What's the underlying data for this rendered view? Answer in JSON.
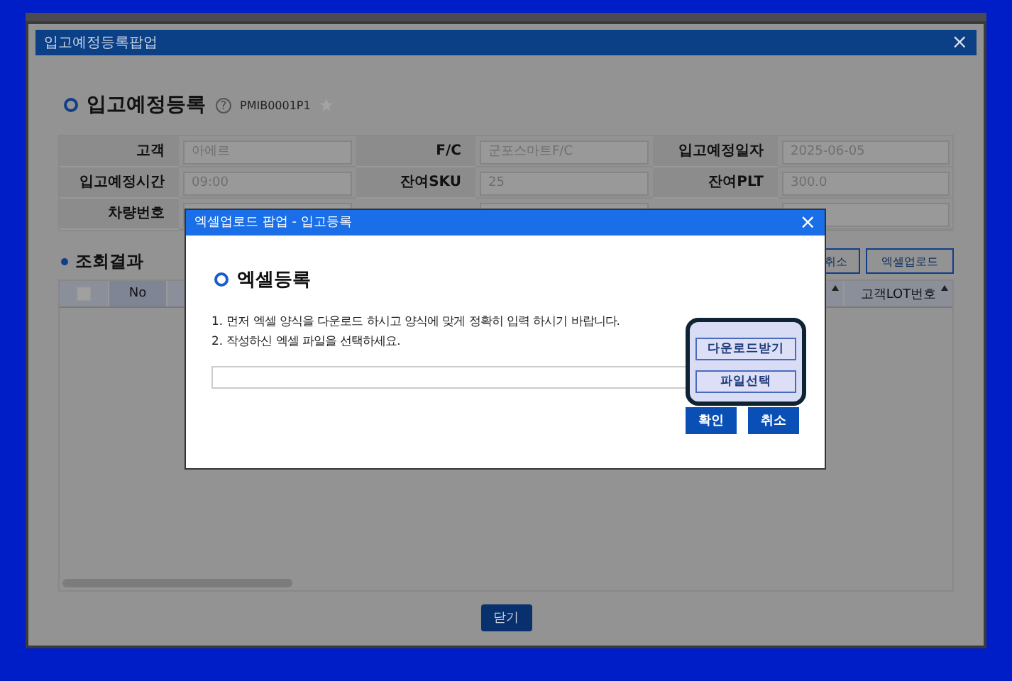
{
  "popup": {
    "title": "입고예정등록팝업",
    "close": "×",
    "heading": "입고예정등록",
    "help": "?",
    "code": "PMIB0001P1",
    "fields": [
      {
        "label": "고객",
        "value": "아에르"
      },
      {
        "label": "F/C",
        "value": "군포스마트F/C"
      },
      {
        "label": "입고예정일자",
        "value": "2025-06-05"
      },
      {
        "label": "입고예정시간",
        "value": "09:00"
      },
      {
        "label": "잔여SKU",
        "value": "25"
      },
      {
        "label": "잔여PLT",
        "value": "300.0"
      },
      {
        "label": "차량번호"
      }
    ],
    "results_title": "조회결과",
    "result_buttons": [
      "취소",
      "엑셀업로드"
    ],
    "columns": [
      {
        "kind": "check",
        "checked": false
      },
      {
        "kind": "text",
        "label": "No"
      },
      {
        "kind": "blank",
        "sort": true
      },
      {
        "kind": "text",
        "label": "고객LOT번호",
        "sort": true
      }
    ],
    "close_button": "닫기"
  },
  "modal": {
    "title": "엑셀업로드 팝업 - 입고등록",
    "close": "×",
    "heading": "엑셀등록",
    "instructions": [
      "1. 먼저 엑셀 양식을 다운로드 하시고 양식에 맞게 정확히 입력 하시기 바랍니다.",
      "2. 작성하신 엑셀 파일을 선택하세요."
    ],
    "side_buttons": [
      "다운로드받기",
      "파일선택"
    ],
    "buttons": [
      "확인",
      "취소"
    ]
  }
}
